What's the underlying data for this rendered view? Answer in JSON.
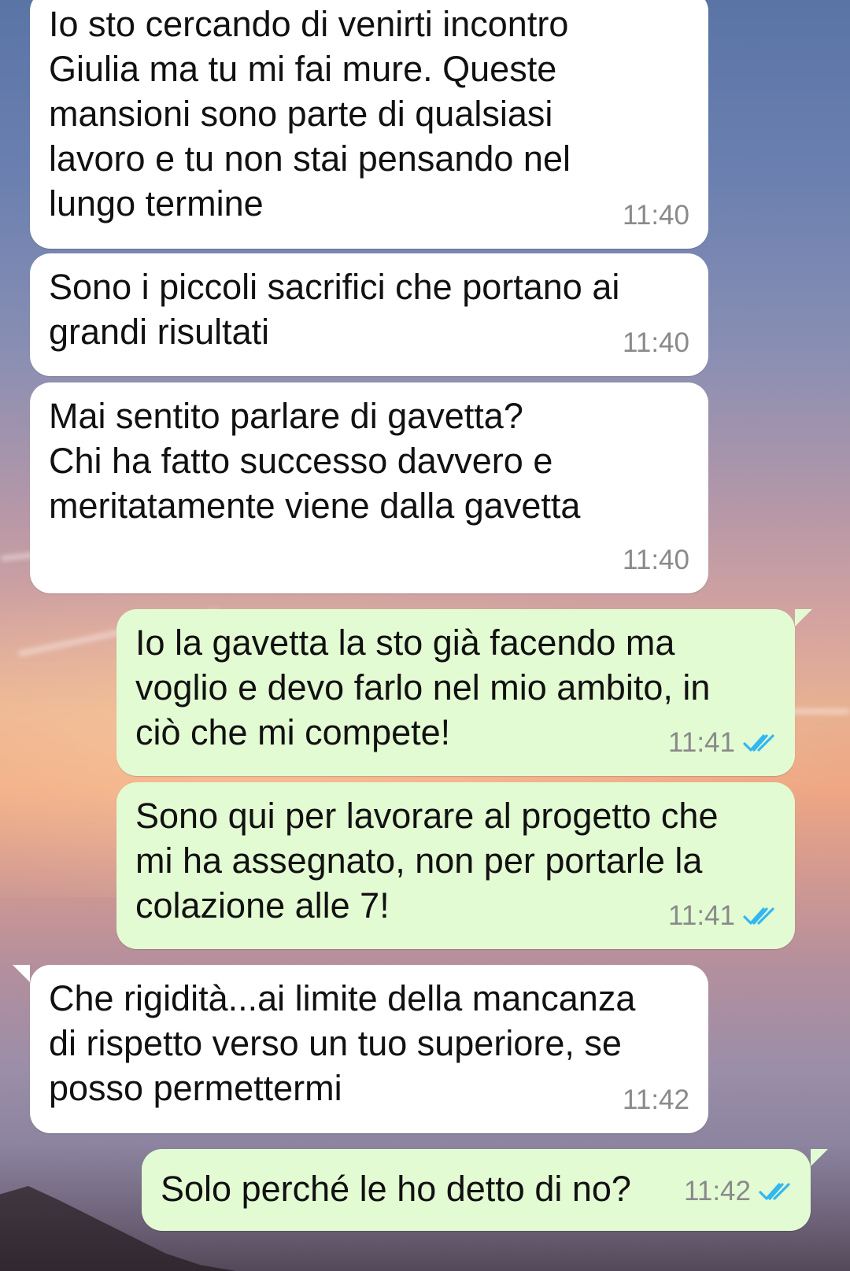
{
  "messages": [
    {
      "direction": "in",
      "text": "Io sto cercando di venirti incontro\nGiulia ma tu mi fai mure. Queste\nmansioni sono parte di qualsiasi\nlavoro e tu non stai pensando nel\nlungo termine",
      "time": "11:40"
    },
    {
      "direction": "in",
      "text": "Sono i piccoli sacrifici che portano ai\ngrandi risultati",
      "time": "11:40"
    },
    {
      "direction": "in",
      "text": "Mai sentito parlare di gavetta?\nChi ha fatto successo davvero e\nmeritatamente viene dalla gavetta",
      "time": "11:40"
    },
    {
      "direction": "out",
      "text": "Io la gavetta la sto già facendo ma\nvoglio e devo farlo nel mio ambito, in\nciò che mi compete!",
      "time": "11:41",
      "status": "read-double-check-icon"
    },
    {
      "direction": "out",
      "text": "Sono qui per lavorare al progetto che\nmi ha assegnato, non per portarle la\ncolazione alle 7!",
      "time": "11:41",
      "status": "read-double-check-icon"
    },
    {
      "direction": "in",
      "text": "Che rigidità...ai limite della mancanza\ndi rispetto verso un tuo superiore, se\nposso permettermi",
      "time": "11:42"
    },
    {
      "direction": "out",
      "text": "Solo perché le ho detto di no?",
      "time": "11:42",
      "status": "read-double-check-icon"
    }
  ],
  "colors": {
    "incoming_bubble": "#ffffff",
    "outgoing_bubble": "#e3fbd3",
    "timestamp": "#8a8a8a",
    "read_check": "#34b7f1"
  }
}
